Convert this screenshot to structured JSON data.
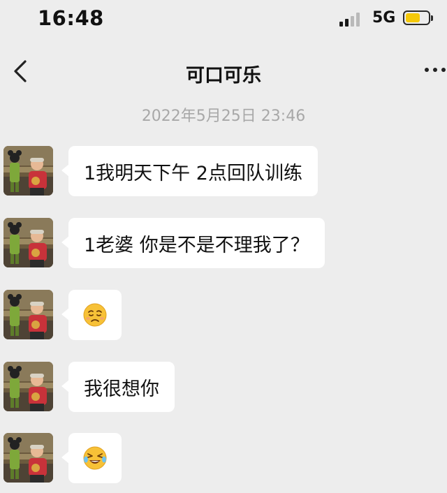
{
  "status_bar": {
    "time": "16:48",
    "network": "5G",
    "battery_level": 0.65,
    "battery_color": "#f5c90a"
  },
  "nav": {
    "back_icon": "chevron-left-icon",
    "title": "可口可乐",
    "more_icon": "more-dots-icon"
  },
  "timestamp": "2022年5月25日 23:46",
  "messages": [
    {
      "type": "text",
      "text": "1我明天下午 2点回队训练"
    },
    {
      "type": "text",
      "text": "1老婆 你是不是不理我了？"
    },
    {
      "type": "emoji",
      "emoji": "pensive-sad-emoji"
    },
    {
      "type": "text",
      "text": "我很想你"
    },
    {
      "type": "emoji",
      "emoji": "crying-laugh-emoji"
    }
  ],
  "colors": {
    "background": "#ededed",
    "bubble": "#ffffff",
    "emoji_yellow": "#f7c137"
  }
}
